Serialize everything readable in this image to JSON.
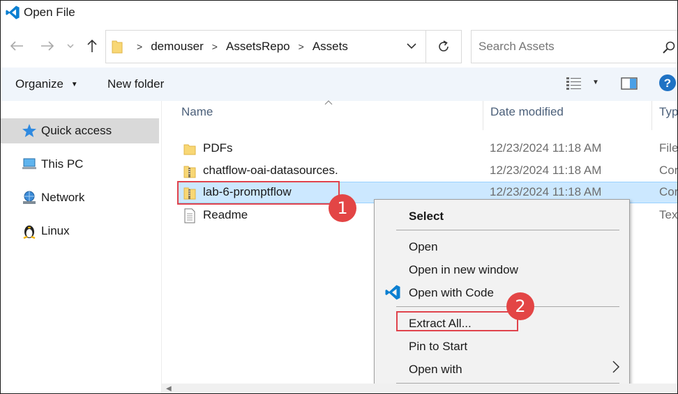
{
  "window": {
    "title": "Open File",
    "app_icon": "vscode-icon"
  },
  "nav": {
    "back": "back-arrow-icon",
    "forward": "forward-arrow-icon",
    "recent": "chevron-down-icon",
    "up": "up-arrow-icon"
  },
  "address": {
    "crumbs": [
      "demouser",
      "AssetsRepo",
      "Assets"
    ]
  },
  "search": {
    "placeholder": "Search Assets"
  },
  "toolbar": {
    "organize_label": "Organize",
    "new_folder_label": "New folder"
  },
  "sidebar": {
    "items": [
      {
        "label": "Quick access",
        "icon": "star-icon",
        "selected": true
      },
      {
        "label": "This PC",
        "icon": "computer-icon"
      },
      {
        "label": "Network",
        "icon": "network-icon"
      },
      {
        "label": "Linux",
        "icon": "linux-penguin-icon"
      }
    ]
  },
  "columns": {
    "name": "Name",
    "date": "Date modified",
    "type": "Typ"
  },
  "files": [
    {
      "name": "PDFs",
      "date": "12/23/2024 11:18 AM",
      "type": "File",
      "icon": "folder-icon"
    },
    {
      "name": "chatflow-oai-datasources.",
      "date": "12/23/2024 11:18 AM",
      "type": "Cor",
      "icon": "zip-folder-icon"
    },
    {
      "name": "lab-6-promptflow",
      "date": "12/23/2024 11:18 AM",
      "type": "Cor",
      "icon": "zip-folder-icon",
      "selected": true
    },
    {
      "name": "Readme",
      "date": "",
      "type": "Text",
      "icon": "text-file-icon"
    }
  ],
  "context_menu": {
    "select": "Select",
    "open": "Open",
    "open_new_window": "Open in new window",
    "open_with_code": "Open with Code",
    "extract_all": "Extract All...",
    "pin_to_start": "Pin to Start",
    "open_with": "Open with"
  },
  "callouts": {
    "one": "1",
    "two": "2"
  },
  "colors": {
    "accent": "#0078d4",
    "selection": "#cce8ff",
    "callout": "#e34545"
  }
}
